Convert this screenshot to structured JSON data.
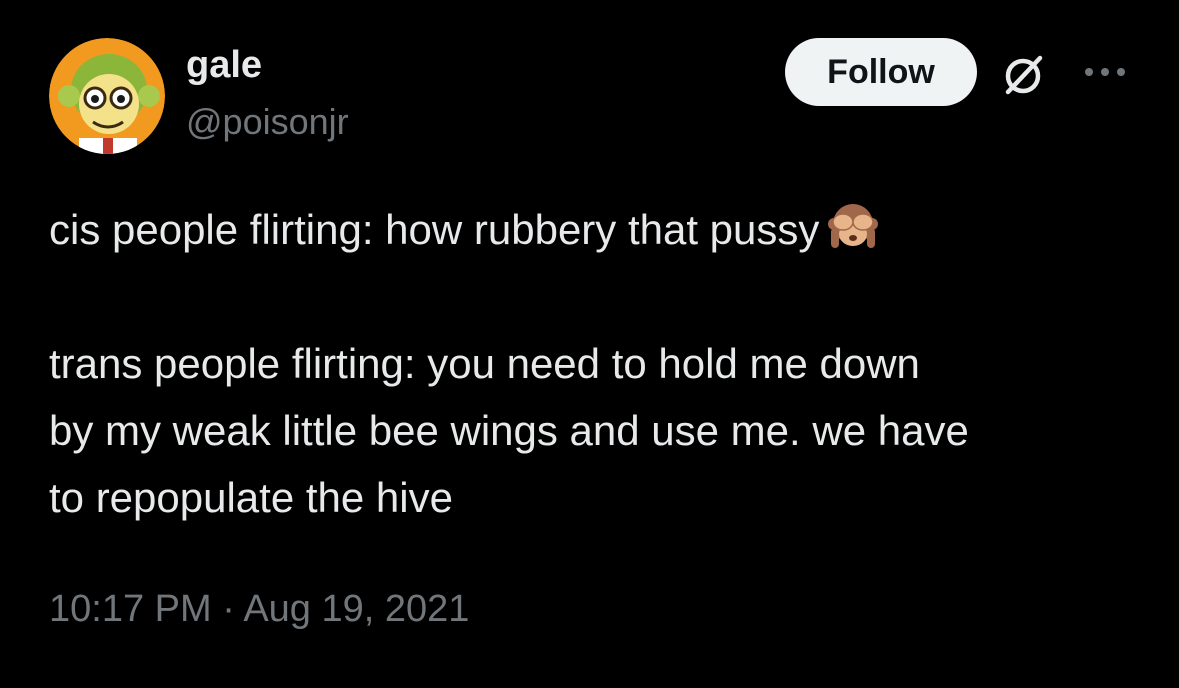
{
  "author": {
    "display_name": "gale",
    "handle": "@poisonjr",
    "avatar_icon": "cartoon-monkey-avatar"
  },
  "actions": {
    "follow_label": "Follow",
    "grok_icon": "grok-slash-icon",
    "more_icon": "more-horizontal-icon"
  },
  "tweet": {
    "line1": "cis people flirting: how rubbery that pussy",
    "line1_emoji": "see-no-evil-monkey-emoji",
    "line2": "trans people flirting: you need to hold me down",
    "line3": "by my weak little bee wings and use me. we have",
    "line4": "to repopulate the hive"
  },
  "meta": {
    "timestamp": "10:17 PM · Aug 19, 2021"
  },
  "colors": {
    "background": "#000000",
    "primary_text": "#e7e9ea",
    "secondary_text": "#71767b",
    "button_bg": "#eff3f4",
    "button_text": "#0f1419"
  }
}
